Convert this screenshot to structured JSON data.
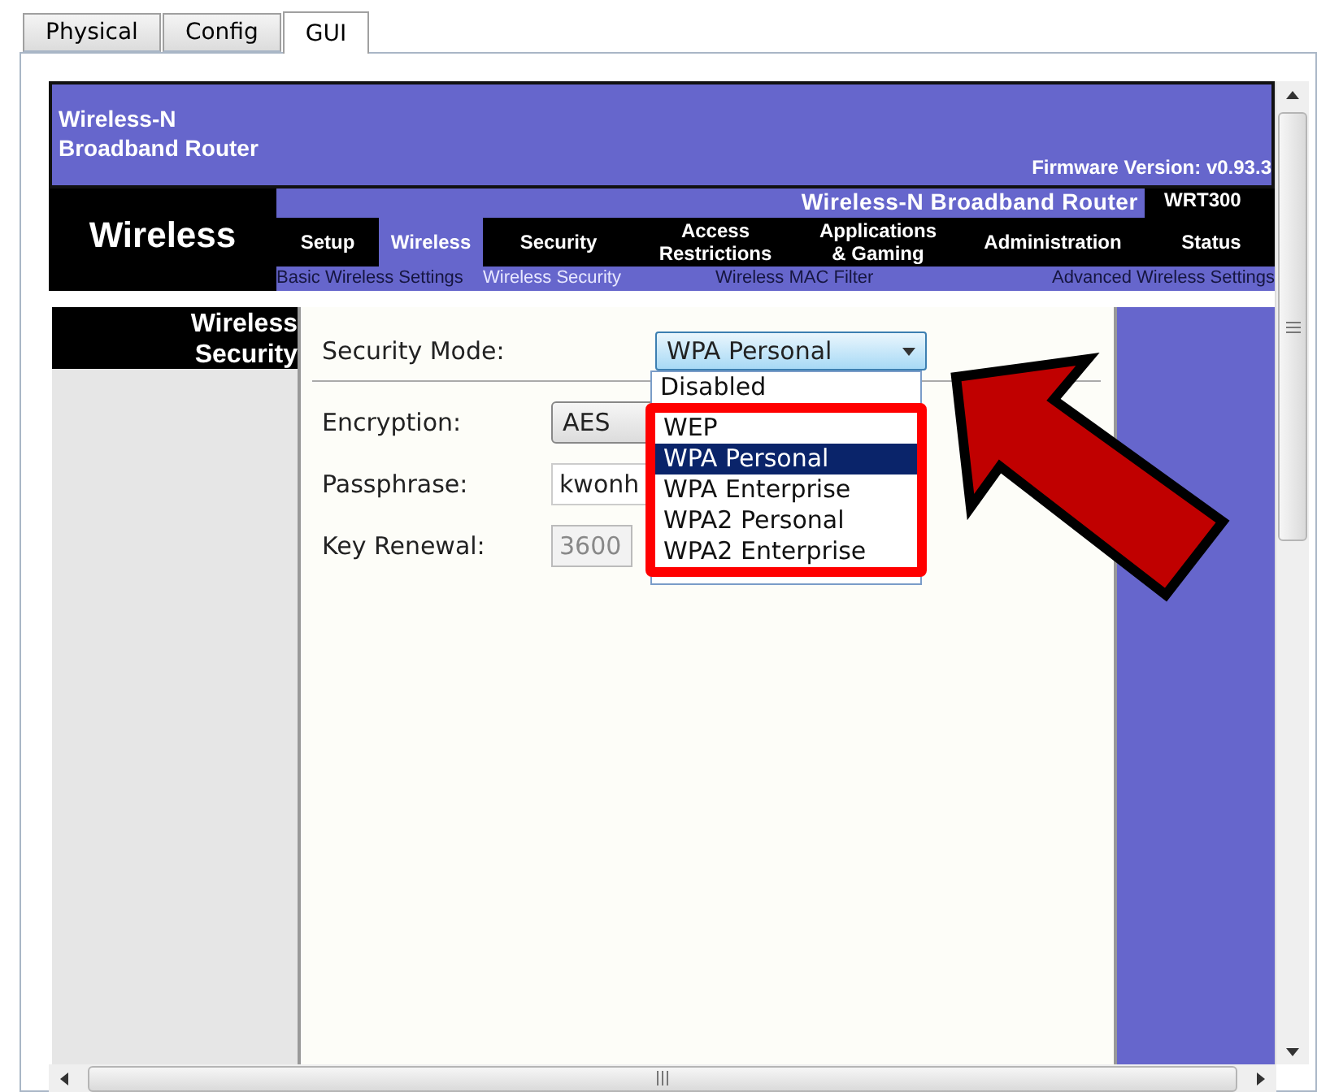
{
  "tabs": [
    {
      "label": "Physical",
      "selected": false
    },
    {
      "label": "Config",
      "selected": false
    },
    {
      "label": "GUI",
      "selected": true
    }
  ],
  "header": {
    "brand_lines": [
      "Wireless-N",
      "Broadband Router"
    ],
    "firmware": "Firmware Version: v0.93.3"
  },
  "nav": {
    "section": "Wireless",
    "title": "Wireless-N Broadband Router",
    "model": "WRT300",
    "menu": [
      {
        "lines": [
          "Setup"
        ],
        "selected": false
      },
      {
        "lines": [
          "Wireless"
        ],
        "selected": true
      },
      {
        "lines": [
          "Security"
        ],
        "selected": false
      },
      {
        "lines": [
          "Access",
          "Restrictions"
        ],
        "selected": false
      },
      {
        "lines": [
          "Applications",
          "& Gaming"
        ],
        "selected": false
      },
      {
        "lines": [
          "Administration"
        ],
        "selected": false
      },
      {
        "lines": [
          "Status"
        ],
        "selected": false
      }
    ],
    "submenu": [
      {
        "label": "Basic Wireless Settings",
        "selected": false
      },
      {
        "label": "Wireless Security",
        "selected": true
      },
      {
        "label": "Wireless MAC Filter",
        "selected": false
      },
      {
        "label": "Advanced Wireless Settings",
        "selected": false
      }
    ]
  },
  "sidebar": {
    "heading_lines": [
      "Wireless",
      "Security"
    ]
  },
  "form": {
    "security_mode": {
      "label": "Security Mode:",
      "value": "WPA Personal",
      "open": true,
      "options": [
        {
          "label": "Disabled",
          "selected": false
        },
        {
          "label": "WEP",
          "selected": false
        },
        {
          "label": "WPA Personal",
          "selected": true
        },
        {
          "label": "WPA Enterprise",
          "selected": false
        },
        {
          "label": "WPA2 Personal",
          "selected": false
        },
        {
          "label": "WPA2 Enterprise",
          "selected": false
        }
      ]
    },
    "fields": [
      {
        "kind": "select",
        "label": "Encryption:",
        "value": "AES",
        "disabled": false
      },
      {
        "kind": "text",
        "label": "Passphrase:",
        "value": "kwonh",
        "disabled": false
      },
      {
        "kind": "text",
        "label": "Key Renewal:",
        "value": "3600",
        "disabled": true
      }
    ]
  }
}
